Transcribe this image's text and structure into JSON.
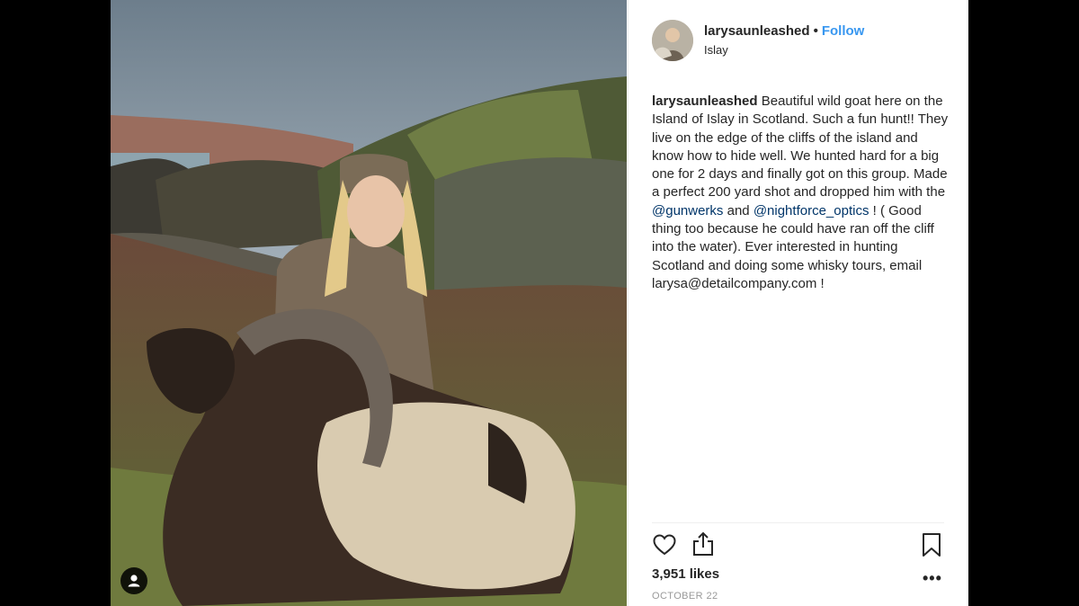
{
  "post": {
    "username": "larysaunleashed",
    "separator": "•",
    "follow_label": "Follow",
    "location": "Islay",
    "caption": {
      "username": "larysaunleashed",
      "text_part1": "Beautiful wild goat here on the Island of Islay in Scotland. Such a fun hunt!! They live on the edge of the cliffs of the island and know how to hide well. We hunted hard for a big one for 2 days and finally got on this group. Made a perfect 200 yard shot and dropped him with the ",
      "mention1": "@gunwerks",
      "text_part2": " and ",
      "mention2": "@nightforce_optics",
      "text_part3": " ! ( Good thing too because he could have ran off the cliff into the water). Ever interested in hunting Scotland and doing some whisky tours, email larysa@detailcompany.com !"
    },
    "likes": "3,951 likes",
    "more": "•••",
    "date": "OCTOBER 22"
  },
  "icons": {
    "like": "heart-icon",
    "share": "share-icon",
    "save": "bookmark-icon",
    "tag": "user-tag-icon"
  },
  "colors": {
    "link": "#3897f0",
    "mention": "#003569",
    "text": "#262626",
    "muted": "#999999"
  }
}
